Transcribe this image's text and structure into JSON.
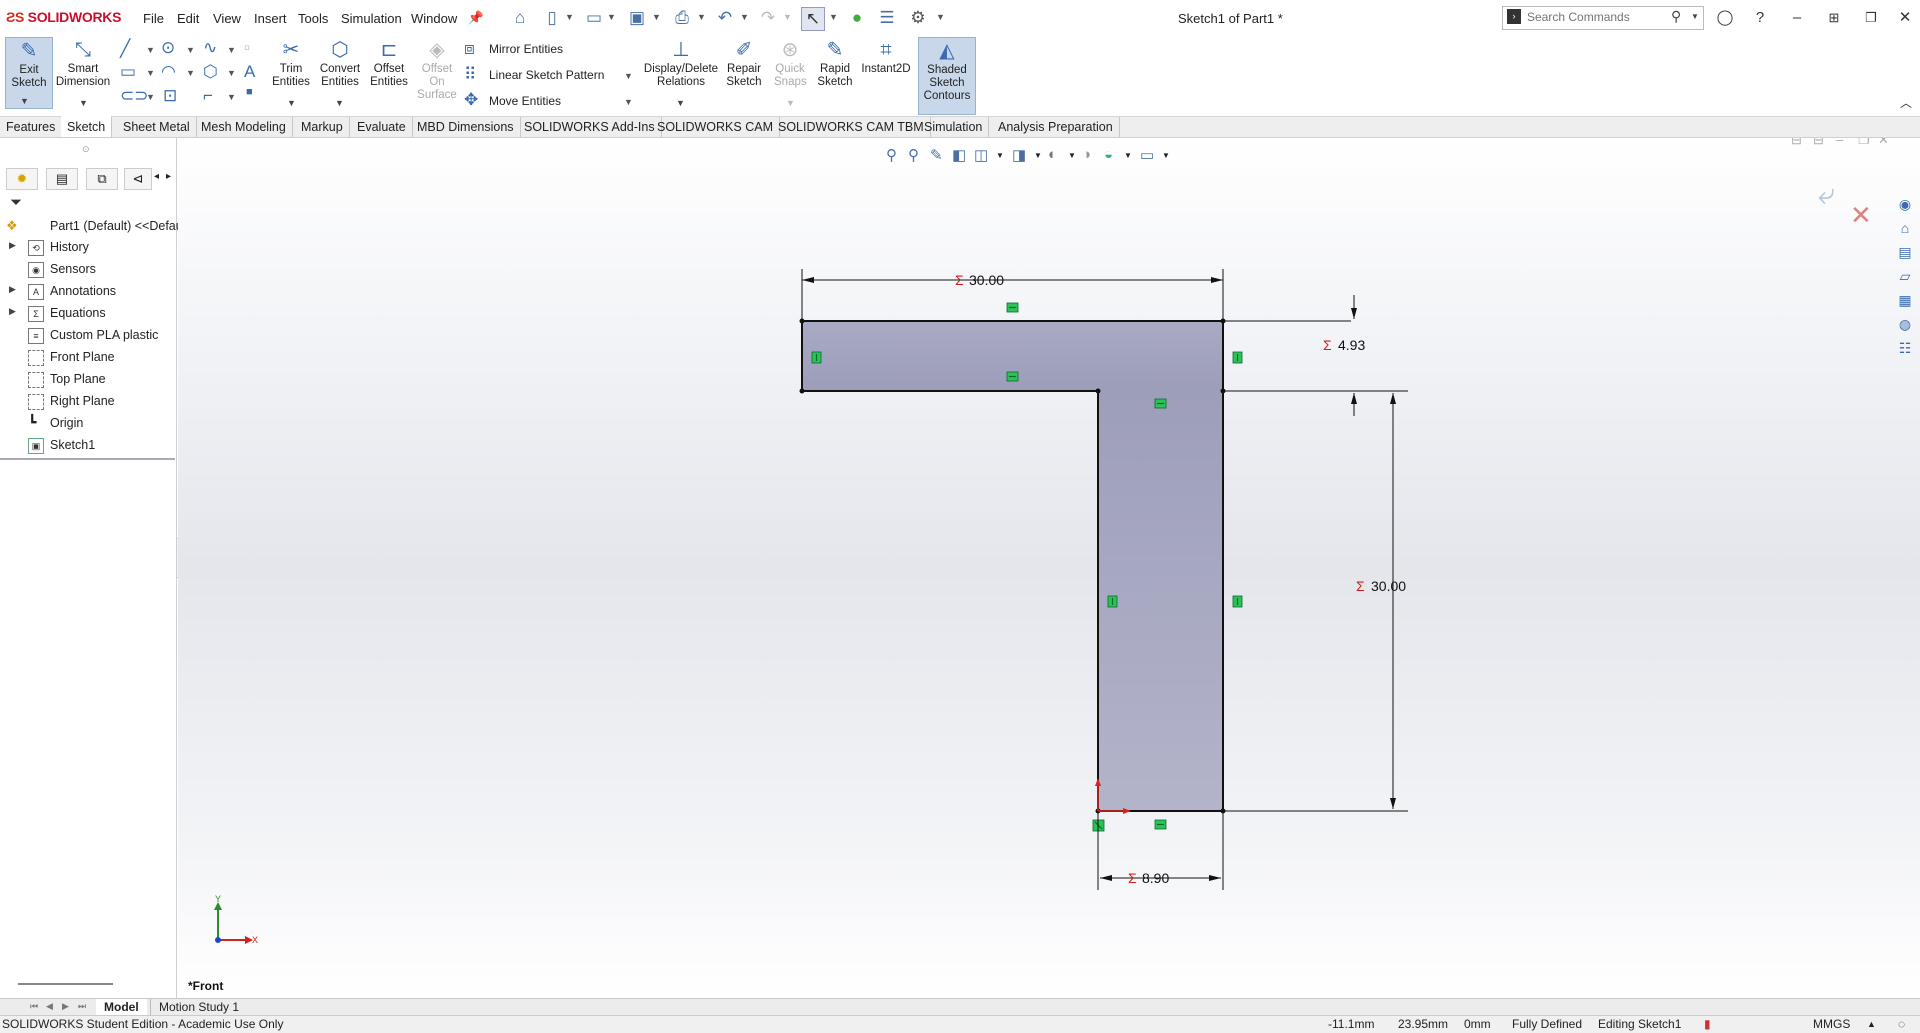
{
  "app": {
    "brand": "SOLIDWORKS",
    "doc_title": "Sketch1 of Part1 *"
  },
  "menu": [
    "File",
    "Edit",
    "View",
    "Insert",
    "Tools",
    "Simulation",
    "Window"
  ],
  "search": {
    "placeholder": "Search Commands"
  },
  "commands": {
    "exit_sketch": "Exit Sketch",
    "smart_dimension": "Smart Dimension",
    "trim_entities": "Trim Entities",
    "convert_entities": "Convert Entities",
    "offset_entities": "Offset Entities",
    "offset_on_surface": "Offset On Surface",
    "mirror_entities": "Mirror Entities",
    "linear_sketch_pattern": "Linear Sketch Pattern",
    "move_entities": "Move Entities",
    "display_delete_relations": "Display/Delete Relations",
    "repair_sketch": "Repair Sketch",
    "quick_snaps": "Quick Snaps",
    "rapid_sketch": "Rapid Sketch",
    "instant2d": "Instant2D",
    "shaded_sketch_contours": "Shaded Sketch Contours"
  },
  "tabs": [
    "Features",
    "Sketch",
    "Sheet Metal",
    "Mesh Modeling",
    "Markup",
    "Evaluate",
    "MBD Dimensions",
    "SOLIDWORKS Add-Ins",
    "SOLIDWORKS CAM",
    "SOLIDWORKS CAM TBM",
    "Simulation",
    "Analysis Preparation"
  ],
  "active_tab": "Sketch",
  "tree": {
    "root": "Part1 (Default) <<Defau",
    "items": [
      "History",
      "Sensors",
      "Annotations",
      "Equations",
      "Custom PLA plastic",
      "Front Plane",
      "Top Plane",
      "Right Plane",
      "Origin",
      "Sketch1"
    ]
  },
  "viewport": {
    "view_label": "*Front",
    "dimensions": {
      "top_width": "30.00",
      "flange_height": "4.93",
      "web_height": "30.00",
      "web_width": "8.90"
    },
    "axis_x": "X",
    "axis_y": "Y"
  },
  "bottom_tabs": [
    "Model",
    "Motion Study 1"
  ],
  "status": {
    "edition": "SOLIDWORKS Student Edition - Academic Use Only",
    "x": "-11.1mm",
    "y": "23.95mm",
    "z": "0mm",
    "state": "Fully Defined",
    "editing": "Editing Sketch1",
    "units": "MMGS"
  },
  "colors": {
    "accent": "#3a6bb0",
    "sketch_fill": "#9c9db8",
    "relation": "#2bc25a",
    "dim_symbol": "#d02020"
  }
}
